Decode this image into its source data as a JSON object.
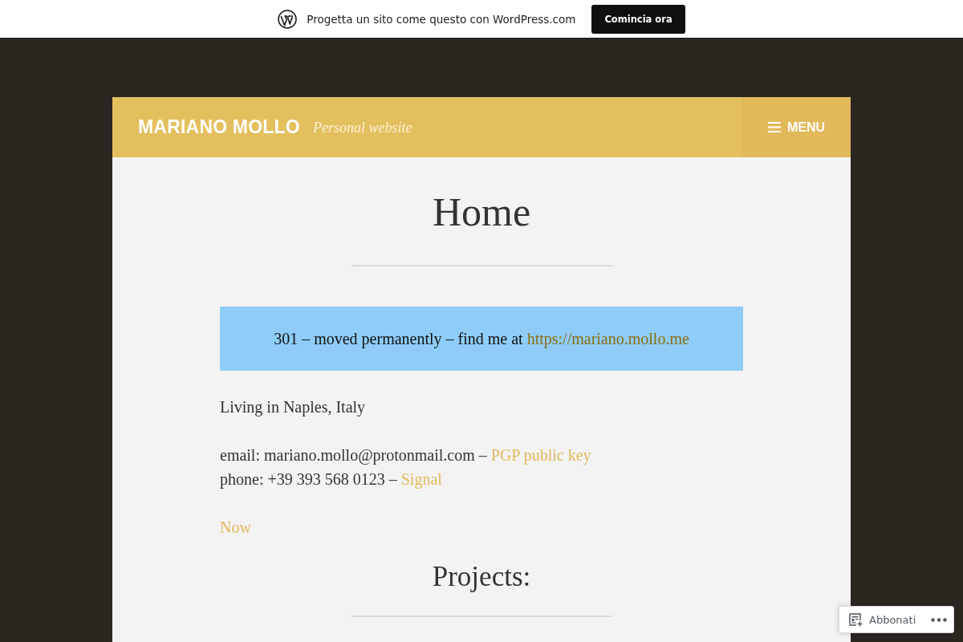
{
  "top_bar": {
    "text": "Progetta un sito come questo con WordPress.com",
    "button": "Comincia ora"
  },
  "header": {
    "site_title": "MARIANO MOLLO",
    "tagline": "Personal website",
    "menu": "MENU"
  },
  "page": {
    "title": "Home",
    "notice": [
      {
        "kind": "text",
        "text": "301 – moved permanently – find me at "
      },
      {
        "kind": "link",
        "text": "https://mariano.mollo.me"
      }
    ],
    "paragraphs": [
      {
        "lines": [
          [
            {
              "kind": "text",
              "text": "Living in Naples, Italy"
            }
          ]
        ]
      },
      {
        "lines": [
          [
            {
              "kind": "text",
              "text": "email: mariano.mollo@protonmail.com – "
            },
            {
              "kind": "link",
              "text": "PGP public key"
            }
          ],
          [
            {
              "kind": "text",
              "text": "phone: +39 393 568 0123 – "
            },
            {
              "kind": "link",
              "text": "Signal"
            }
          ]
        ]
      },
      {
        "lines": [
          [
            {
              "kind": "link",
              "text": "Now"
            }
          ]
        ]
      }
    ],
    "section_heading": "Projects:"
  },
  "subscribe_bar": {
    "button": "Abbonati"
  }
}
